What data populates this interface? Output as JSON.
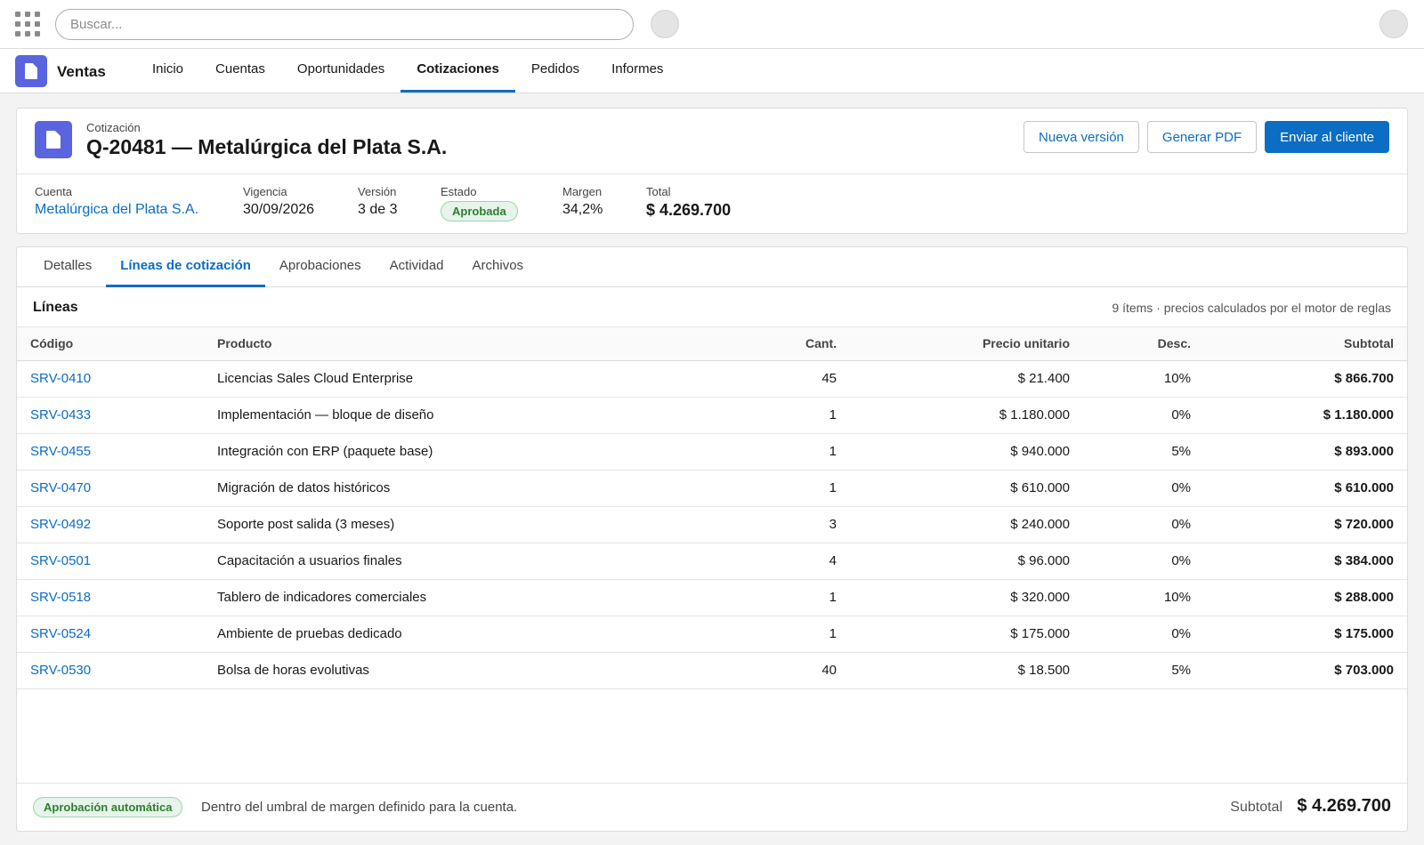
{
  "search": {
    "placeholder": "Buscar..."
  },
  "app": {
    "name": "Ventas",
    "nav": [
      "Inicio",
      "Cuentas",
      "Oportunidades",
      "Cotizaciones",
      "Pedidos",
      "Informes"
    ],
    "active_nav": "Cotizaciones"
  },
  "record": {
    "type": "Cotización",
    "title": "Q-20481 — Metalúrgica del Plata S.A.",
    "actions": {
      "new_version": "Nueva versión",
      "pdf": "Generar PDF",
      "send": "Enviar al cliente"
    },
    "fields": {
      "account_label": "Cuenta",
      "account": "Metalúrgica del Plata S.A.",
      "validity_label": "Vigencia",
      "validity": "30/09/2026",
      "version_label": "Versión",
      "version": "3 de 3",
      "status_label": "Estado",
      "status": "Aprobada",
      "margin_label": "Margen",
      "margin": "34,2%",
      "total_label": "Total",
      "total": "$ 4.269.700"
    }
  },
  "tabs": [
    "Detalles",
    "Líneas de cotización",
    "Aprobaciones",
    "Actividad",
    "Archivos"
  ],
  "active_tab": "Líneas de cotización",
  "lines": {
    "title": "Líneas",
    "meta": "9 ítems · precios calculados por el motor de reglas",
    "columns": {
      "code": "Código",
      "product": "Producto",
      "qty": "Cant.",
      "price": "Precio unitario",
      "disc": "Desc.",
      "subtotal": "Subtotal"
    },
    "rows": [
      {
        "code": "SRV-0410",
        "product": "Licencias Sales Cloud Enterprise",
        "qty": "45",
        "price": "$ 21.400",
        "disc": "10%",
        "subtotal": "$ 866.700"
      },
      {
        "code": "SRV-0433",
        "product": "Implementación — bloque de diseño",
        "qty": "1",
        "price": "$ 1.180.000",
        "disc": "0%",
        "subtotal": "$ 1.180.000"
      },
      {
        "code": "SRV-0455",
        "product": "Integración con ERP (paquete base)",
        "qty": "1",
        "price": "$ 940.000",
        "disc": "5%",
        "subtotal": "$ 893.000"
      },
      {
        "code": "SRV-0470",
        "product": "Migración de datos históricos",
        "qty": "1",
        "price": "$ 610.000",
        "disc": "0%",
        "subtotal": "$ 610.000"
      },
      {
        "code": "SRV-0492",
        "product": "Soporte post salida (3 meses)",
        "qty": "3",
        "price": "$ 240.000",
        "disc": "0%",
        "subtotal": "$ 720.000"
      },
      {
        "code": "SRV-0501",
        "product": "Capacitación a usuarios finales",
        "qty": "4",
        "price": "$ 96.000",
        "disc": "0%",
        "subtotal": "$ 384.000"
      },
      {
        "code": "SRV-0518",
        "product": "Tablero de indicadores comerciales",
        "qty": "1",
        "price": "$ 320.000",
        "disc": "10%",
        "subtotal": "$ 288.000"
      },
      {
        "code": "SRV-0524",
        "product": "Ambiente de pruebas dedicado",
        "qty": "1",
        "price": "$ 175.000",
        "disc": "0%",
        "subtotal": "$ 175.000"
      },
      {
        "code": "SRV-0530",
        "product": "Bolsa de horas evolutivas",
        "qty": "40",
        "price": "$ 18.500",
        "disc": "5%",
        "subtotal": "$ 703.000"
      }
    ]
  },
  "footer": {
    "badge": "Aprobación automática",
    "note": "Dentro del umbral de margen definido para la cuenta.",
    "subtotal_label": "Subtotal",
    "subtotal": "$ 4.269.700"
  },
  "colors": {
    "accent": "#0b6dc3",
    "app_icon": "#5a63e0",
    "success": "#2e7d32"
  },
  "icons": {
    "launcher": "app-launcher-icon",
    "record": "quote-document-icon"
  }
}
